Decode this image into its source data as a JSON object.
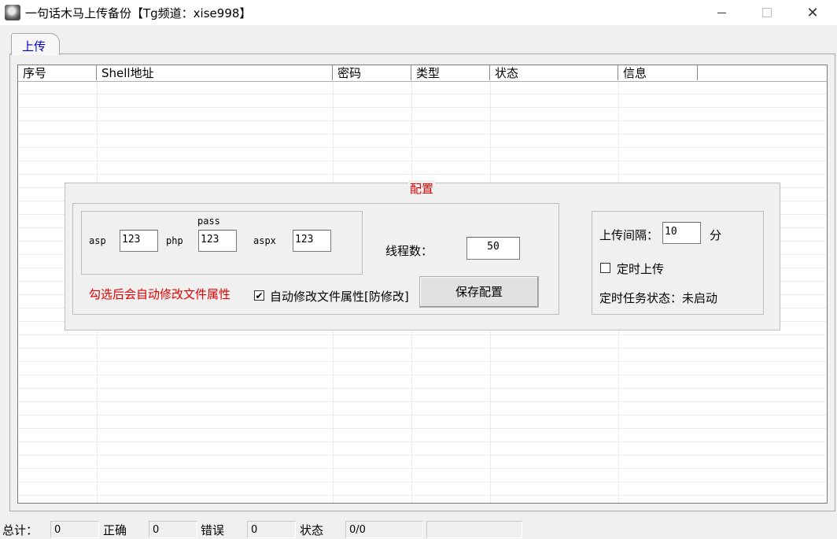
{
  "window": {
    "title": "一句话木马上传备份【Tg频道：xise998】",
    "minimize": "—",
    "close": "✕"
  },
  "tabs": [
    {
      "label": "上传"
    }
  ],
  "grid": {
    "columns": [
      "序号",
      "Shell地址",
      "密码",
      "类型",
      "状态",
      "信息"
    ]
  },
  "config": {
    "title": "配置",
    "pass_label": "pass",
    "asp_label": "asp",
    "asp_value": "123",
    "php_label": "php",
    "php_value": "123",
    "aspx_label": "aspx",
    "aspx_value": "123",
    "threads_label": "线程数：",
    "threads_value": "50",
    "hint": "勾选后会自动修改文件属性",
    "auto_modify_label": "自动修改文件属性[防修改]",
    "auto_modify_checked": true,
    "save_button": "保存配置",
    "interval_label": "上传间隔：",
    "interval_value": "10",
    "interval_unit": "分",
    "timer_label": "定时上传",
    "timer_checked": false,
    "timer_status": "定时任务状态：未启动"
  },
  "statusbar": {
    "total_label": "总计：",
    "total_value": "0",
    "ok_label": "正确",
    "ok_value": "0",
    "err_label": "错误",
    "err_value": "0",
    "state_label": "状态",
    "state_value": "0/0"
  },
  "colors": {
    "accent_red": "#e00000",
    "tab_blue": "#0000cc"
  }
}
